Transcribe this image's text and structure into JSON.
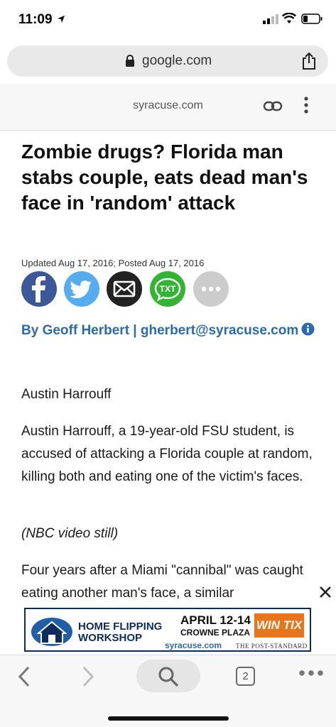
{
  "status_bar": {
    "time": "11:09"
  },
  "browser": {
    "url": "google.com"
  },
  "amp_header": {
    "site": "syracuse.com"
  },
  "article": {
    "headline": "Zombie drugs? Florida man stabs couple, eats dead man's face in 'random' attack",
    "dateline": "Updated Aug 17, 2016; Posted Aug 17, 2016",
    "share_buttons": [
      {
        "icon": "facebook-icon",
        "color": "#3b5998"
      },
      {
        "icon": "twitter-icon",
        "color": "#55acee"
      },
      {
        "icon": "email-icon",
        "color": "#222222"
      },
      {
        "icon": "sms-icon",
        "label": "TXT",
        "color": "#33b533"
      },
      {
        "icon": "more-icon",
        "color": "#cccccc"
      }
    ],
    "byline": "By Geoff Herbert | gherbert@syracuse.com",
    "caption_name": "Austin Harrouff",
    "caption_text": "Austin Harrouff, a 19-year-old FSU student, is accused of attacking a Florida couple at random, killing both and eating one of the victim's faces.",
    "credit": "(NBC video still)",
    "body": "Four years after a Miami \"cannibal\" was caught eating another man's face, a similar"
  },
  "ad": {
    "line1": "HOME FLIPPING",
    "line2": "WORKSHOP",
    "date": "APRIL 12-14",
    "venue": "CROWNE PLAZA",
    "cta": "WIN TIX",
    "sponsor1": "syracuse.com",
    "sponsor2": "THE POST-STANDARD"
  },
  "toolbar": {
    "tab_count": "2"
  },
  "colors": {
    "link": "#2a6bb0",
    "ad_accent": "#e8741c",
    "ad_navy": "#0d2b5c"
  }
}
